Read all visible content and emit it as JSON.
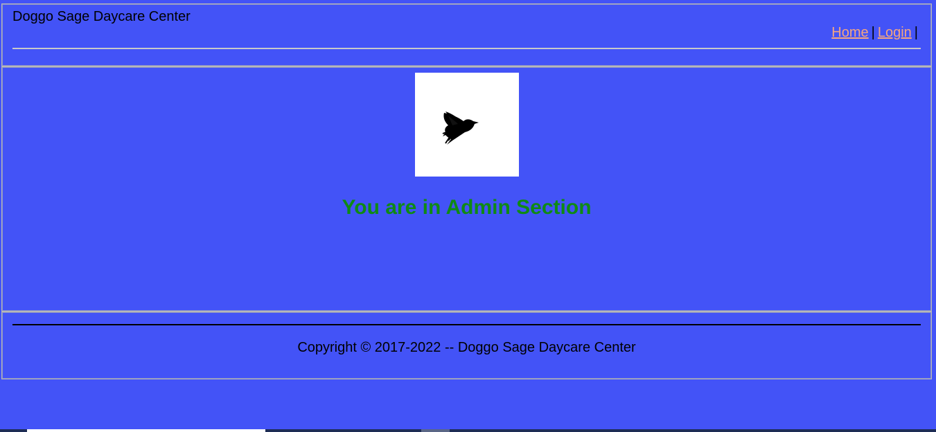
{
  "header": {
    "site_title": "Doggo Sage Daycare Center",
    "nav": {
      "home_label": "Home",
      "login_label": "Login",
      "separator": "|"
    }
  },
  "main": {
    "logo_icon": "bird-icon",
    "heading": "You are in Admin Section"
  },
  "footer": {
    "copyright": "Copyright © 2017-2022 -- Doggo Sage Daycare Center"
  },
  "colors": {
    "background": "#4353f7",
    "link": "#f4a582",
    "heading": "#0f8a14"
  }
}
